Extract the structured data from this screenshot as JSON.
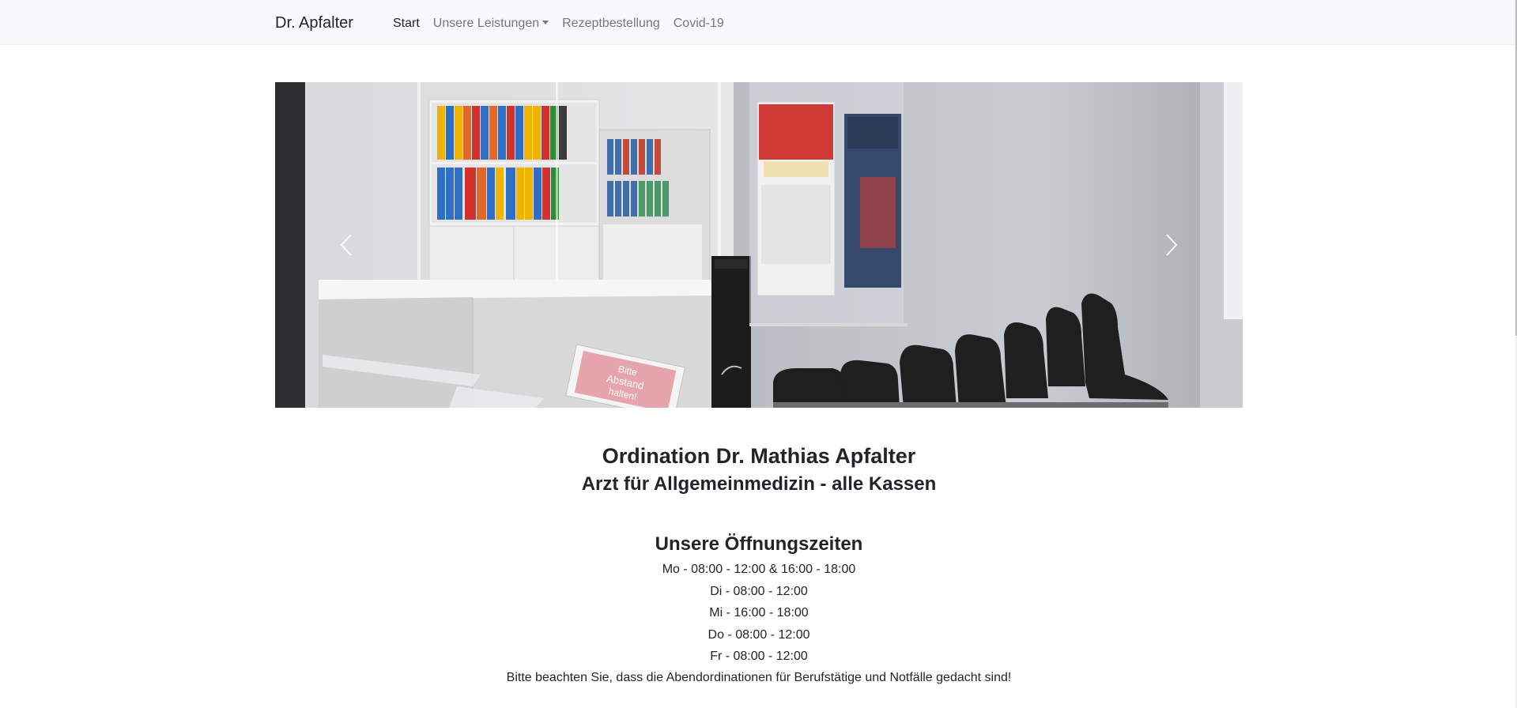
{
  "navbar": {
    "brand": "Dr. Apfalter",
    "items": [
      {
        "label": "Start",
        "active": true
      },
      {
        "label": "Unsere Leistungen",
        "dropdown": true
      },
      {
        "label": "Rezeptbestellung"
      },
      {
        "label": "Covid-19"
      }
    ]
  },
  "carousel": {
    "prev_icon": "chevron-left-icon",
    "next_icon": "chevron-right-icon",
    "sign_text": [
      "Bitte",
      "Abstand",
      "halten!"
    ]
  },
  "main": {
    "title": "Ordination Dr. Mathias Apfalter",
    "subtitle": "Arzt für Allgemeinmedizin - alle Kassen",
    "hours_heading": "Unsere Öffnungszeiten",
    "hours": [
      "Mo - 08:00 - 12:00 & 16:00 - 18:00",
      "Di - 08:00 - 12:00",
      "Mi - 16:00 - 18:00",
      "Do - 08:00 - 12:00",
      "Fr - 08:00 - 12:00"
    ],
    "note": "Bitte beachten Sie, dass die Abendordinationen für Berufstätige und Notfälle gedacht sind!"
  },
  "colors": {
    "navbar_bg": "#f8f9fa",
    "nav_link": "#73787d",
    "nav_active": "#212529",
    "text": "#212529"
  }
}
